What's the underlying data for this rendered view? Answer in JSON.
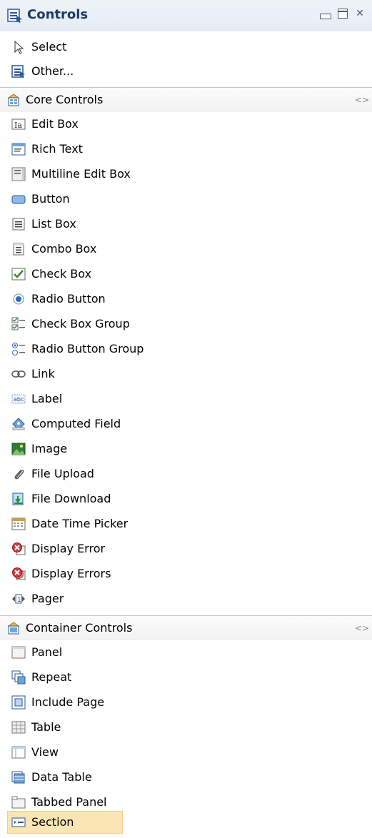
{
  "title": "Controls",
  "top_items": [
    {
      "label": "Select",
      "icon": "pointer-icon"
    },
    {
      "label": "Other...",
      "icon": "other-controls-icon"
    }
  ],
  "sections": [
    {
      "title": "Core Controls",
      "items": [
        {
          "label": "Edit Box",
          "icon": "edit-box-icon"
        },
        {
          "label": "Rich Text",
          "icon": "rich-text-icon"
        },
        {
          "label": "Multiline Edit Box",
          "icon": "multiline-edit-box-icon"
        },
        {
          "label": "Button",
          "icon": "button-icon"
        },
        {
          "label": "List Box",
          "icon": "list-box-icon"
        },
        {
          "label": "Combo Box",
          "icon": "combo-box-icon"
        },
        {
          "label": "Check Box",
          "icon": "check-box-icon"
        },
        {
          "label": "Radio Button",
          "icon": "radio-button-icon"
        },
        {
          "label": "Check Box Group",
          "icon": "check-box-group-icon"
        },
        {
          "label": "Radio Button Group",
          "icon": "radio-button-group-icon"
        },
        {
          "label": "Link",
          "icon": "link-icon"
        },
        {
          "label": "Label",
          "icon": "label-icon"
        },
        {
          "label": "Computed Field",
          "icon": "computed-field-icon"
        },
        {
          "label": "Image",
          "icon": "image-icon"
        },
        {
          "label": "File Upload",
          "icon": "file-upload-icon"
        },
        {
          "label": "File Download",
          "icon": "file-download-icon"
        },
        {
          "label": "Date Time Picker",
          "icon": "date-time-picker-icon"
        },
        {
          "label": "Display Error",
          "icon": "display-error-icon"
        },
        {
          "label": "Display Errors",
          "icon": "display-errors-icon"
        },
        {
          "label": "Pager",
          "icon": "pager-icon"
        }
      ]
    },
    {
      "title": "Container Controls",
      "items": [
        {
          "label": "Panel",
          "icon": "panel-icon"
        },
        {
          "label": "Repeat",
          "icon": "repeat-icon"
        },
        {
          "label": "Include Page",
          "icon": "include-page-icon"
        },
        {
          "label": "Table",
          "icon": "table-icon"
        },
        {
          "label": "View",
          "icon": "view-icon"
        },
        {
          "label": "Data Table",
          "icon": "data-table-icon"
        },
        {
          "label": "Tabbed Panel",
          "icon": "tabbed-panel-icon"
        },
        {
          "label": "Section",
          "icon": "section-icon",
          "selected": true
        }
      ]
    }
  ],
  "colors": {
    "title": "#1f3b63",
    "selected_bg": "#fce5b5"
  }
}
